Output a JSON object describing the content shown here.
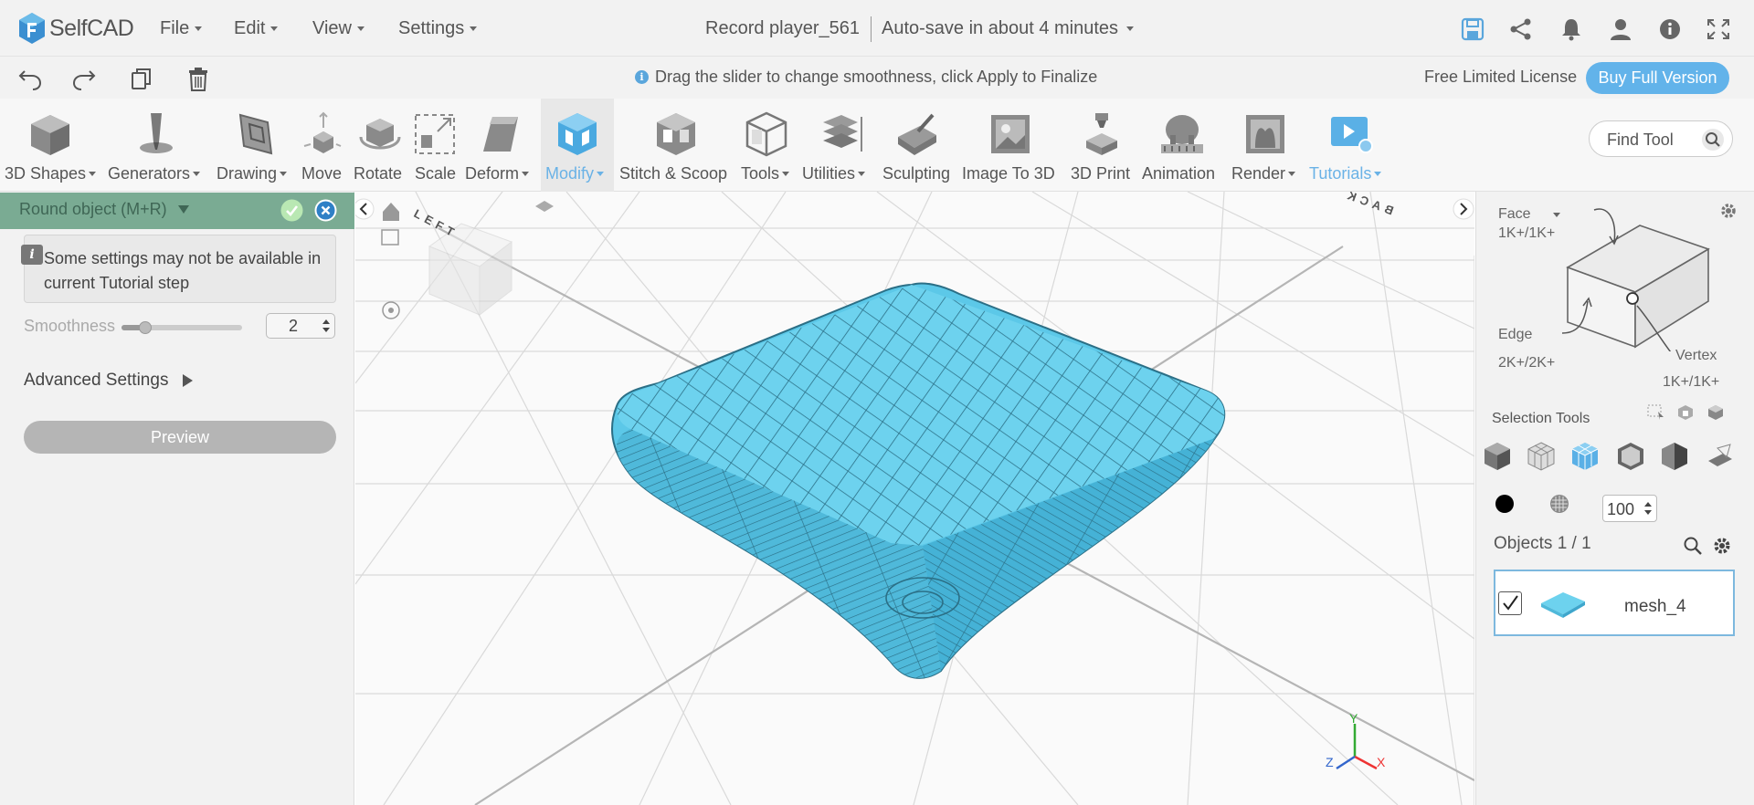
{
  "app": {
    "name": "SelfCAD"
  },
  "menu": {
    "file": "File",
    "edit": "Edit",
    "view": "View",
    "settings": "Settings"
  },
  "document": {
    "name": "Record player_561",
    "autosave": "Auto-save in about 4 minutes"
  },
  "topicons": [
    "save-icon",
    "share-icon",
    "bell-icon",
    "user-icon",
    "info-icon",
    "fullscreen-icon"
  ],
  "hint": "Drag the slider to change smoothness, click Apply to Finalize",
  "license": {
    "text": "Free Limited License",
    "buy": "Buy Full Version"
  },
  "toolbar": {
    "shapes": "3D Shapes",
    "generators": "Generators",
    "drawing": "Drawing",
    "move": "Move",
    "rotate": "Rotate",
    "scale": "Scale",
    "deform": "Deform",
    "modify": "Modify",
    "stitch": "Stitch & Scoop",
    "tools": "Tools",
    "utilities": "Utilities",
    "sculpting": "Sculpting",
    "image3d": "Image To 3D",
    "print": "3D Print",
    "animation": "Animation",
    "render": "Render",
    "tutorials": "Tutorials",
    "find_placeholder": "Find Tool"
  },
  "left_panel": {
    "title": "Round object (M+R)",
    "notice": "Some settings may not be available in current Tutorial step",
    "smoothness_label": "Smoothness",
    "smoothness_value": "2",
    "smoothness_level": 0.2,
    "advanced": "Advanced Settings",
    "preview": "Preview"
  },
  "viewport": {
    "cube_left": "LEFT",
    "cube_back": "BACK",
    "axes": {
      "x": "X",
      "y": "Y",
      "z": "Z"
    }
  },
  "right_panel": {
    "face": "Face",
    "face_count": "1K+/1K+",
    "edge": "Edge",
    "edge_count": "2K+/2K+",
    "vertex": "Vertex",
    "vertex_count": "1K+/1K+",
    "selection_tools": "Selection Tools",
    "opacity": "100",
    "objects_label": "Objects 1 / 1",
    "object_name": "mesh_4"
  },
  "colors": {
    "accent": "#62b3ea",
    "mesh": "#5cc8e8",
    "panel_header": "#7aab93"
  }
}
